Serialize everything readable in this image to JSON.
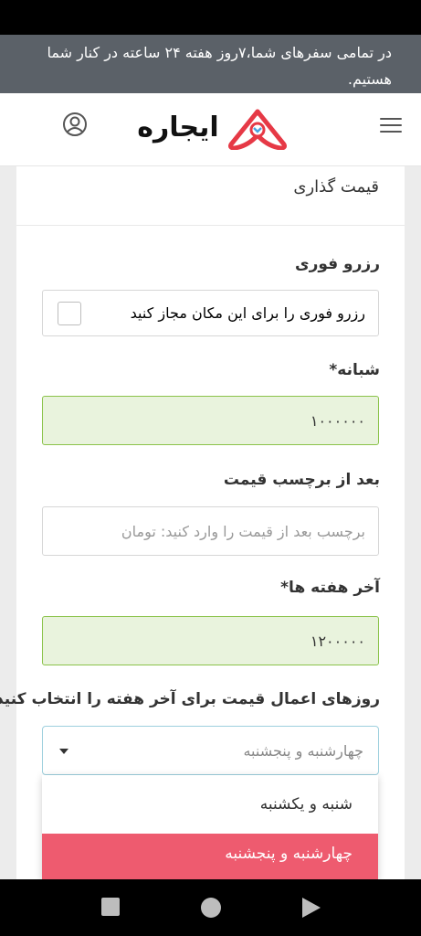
{
  "banner": {
    "text": "در تمامی سفرهای شما،۷روز هفته ۲۴ ساعته در کنار شما هستیم."
  },
  "header": {
    "logo_text": "ایجاره"
  },
  "card": {
    "title": "قیمت گذاری",
    "instant": {
      "label": "رزرو فوری",
      "checkbox_label": "رزرو فوری را برای این مکان مجاز کنید"
    },
    "nightly": {
      "label": "شبانه*",
      "value": "۱۰۰۰۰۰۰"
    },
    "suffix": {
      "label": "بعد از برچسب قیمت",
      "placeholder": "برچسب بعد از قیمت را وارد کنید: تومان"
    },
    "weekend": {
      "label": "آخر هفته ها*",
      "value": "۱۲۰۰۰۰۰"
    },
    "days": {
      "label": "روزهای اعمال قیمت برای آخر هفته را انتخاب کنید*",
      "selected": "چهارشنبه و پنجشنبه",
      "options": [
        "شنبه و یکشنبه",
        "چهارشنبه و پنجشنبه"
      ]
    }
  },
  "colors": {
    "accent": "#ee5b6f",
    "valid_bg": "#e9f3dd",
    "valid_border": "#8bc34a",
    "banner_bg": "#5b6168"
  }
}
